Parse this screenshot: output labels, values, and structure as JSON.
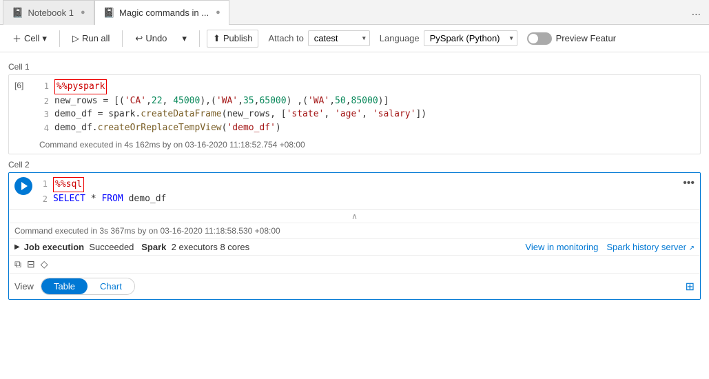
{
  "tabs": [
    {
      "id": "nb1",
      "label": "Notebook 1",
      "icon": "📓",
      "active": false
    },
    {
      "id": "magic",
      "label": "Magic commands in ...",
      "icon": "📓",
      "active": true
    }
  ],
  "tab_more": "...",
  "toolbar": {
    "cell_label": "Cell",
    "run_all_label": "Run all",
    "undo_label": "Undo",
    "publish_label": "Publish",
    "attach_label": "Attach to",
    "attach_value": "catest",
    "lang_label": "Language",
    "lang_value": "PySpark (Python)",
    "preview_label": "Preview Featur"
  },
  "cell1": {
    "label": "Cell 1",
    "exec_num": "[6]",
    "lines": [
      {
        "num": "1",
        "code": "%%pyspark",
        "magic": true
      },
      {
        "num": "2",
        "code": "new_rows = [('CA',22, 45000),('WA',35,65000) ,('WA',50,85000)]"
      },
      {
        "num": "3",
        "code": "demo_df = spark.createDataFrame(new_rows, ['state', 'age', 'salary'])"
      },
      {
        "num": "4",
        "code": "demo_df.createOrReplaceTempView('demo_df')"
      }
    ],
    "status": "Command executed in 4s 162ms by    on 03-16-2020 11:18:52.754 +08:00"
  },
  "cell2": {
    "label": "Cell 2",
    "lines": [
      {
        "num": "1",
        "code": "%%sql",
        "magic": true
      },
      {
        "num": "2",
        "code": "SELECT * FROM demo_df"
      }
    ],
    "status": "Command executed in 3s 367ms by    on 03-16-2020 11:18:58.530 +08:00",
    "job": {
      "status": "Job execution",
      "result": "Succeeded",
      "spark": "Spark",
      "executors": "2 executors 8 cores"
    },
    "view_monitoring": "View in monitoring",
    "spark_history": "Spark history server",
    "view_label": "View",
    "view_table": "Table",
    "view_chart": "Chart"
  }
}
